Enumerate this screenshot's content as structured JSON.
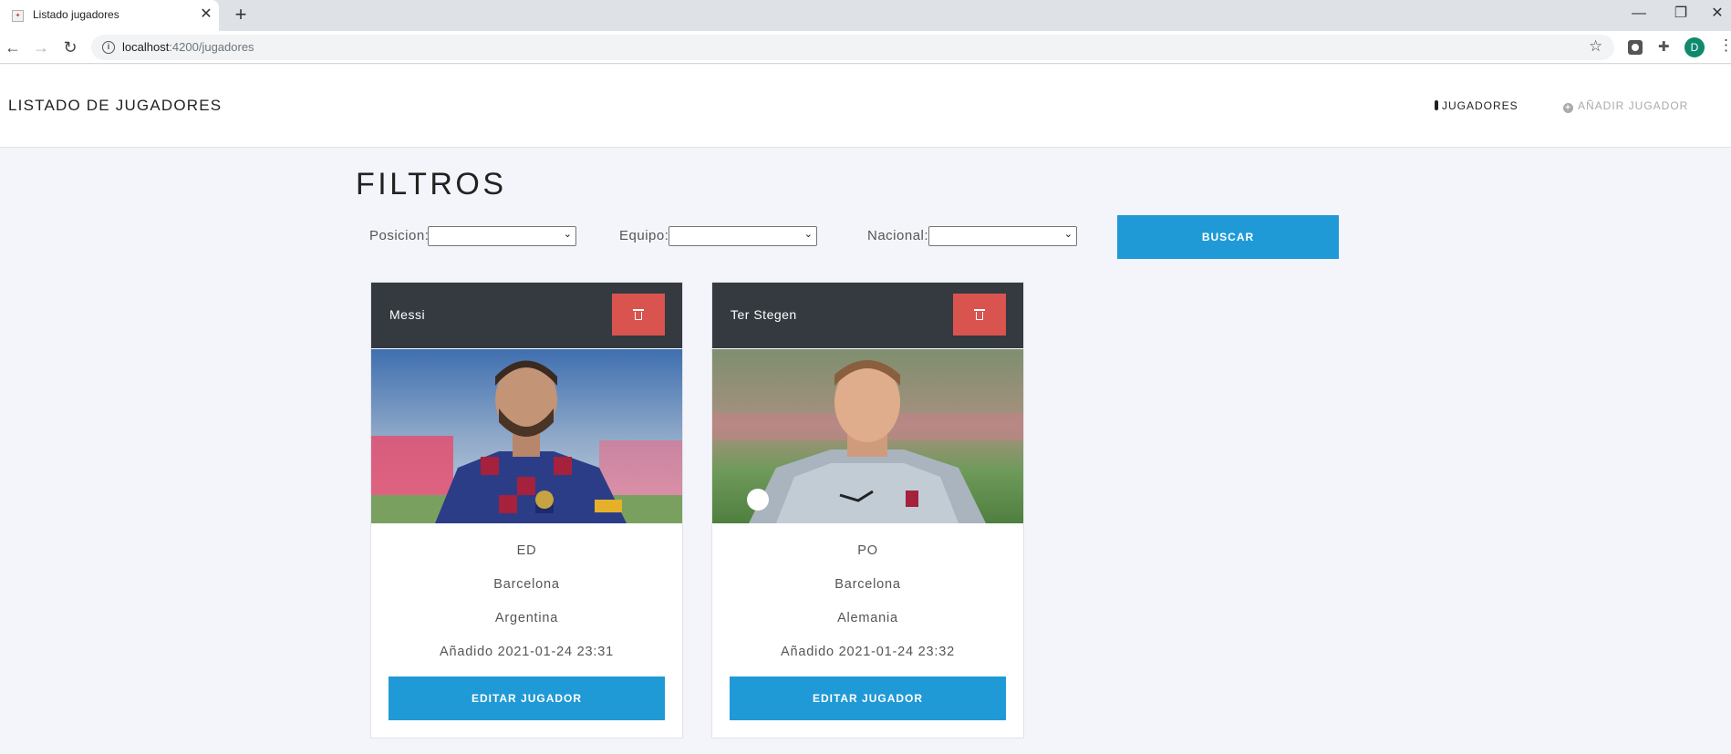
{
  "browser": {
    "tab_title": "Listado jugadores",
    "url_host": "localhost",
    "url_rest": ":4200/jugadores",
    "profile_initial": "D"
  },
  "navbar": {
    "brand": "LISTADO DE JUGADORES",
    "links": [
      "JUGADORES",
      "AÑADIR JUGADOR"
    ]
  },
  "filters": {
    "title": "FILTROS",
    "labels": [
      "Posicion:",
      "Equipo:",
      "Nacional:"
    ],
    "search_label": "BUSCAR"
  },
  "players": [
    {
      "name": "Messi",
      "position": "ED",
      "team": "Barcelona",
      "nationality": "Argentina",
      "added": "Añadido 2021-01-24 23:31",
      "edit_label": "EDITAR JUGADOR"
    },
    {
      "name": "Ter Stegen",
      "position": "PO",
      "team": "Barcelona",
      "nationality": "Alemania",
      "added": "Añadido 2021-01-24 23:32",
      "edit_label": "EDITAR JUGADOR"
    }
  ],
  "colors": {
    "primary": "#1f9ad6",
    "danger": "#d9534f",
    "card_header": "#343a40",
    "page_bg": "#f4f5fb"
  }
}
